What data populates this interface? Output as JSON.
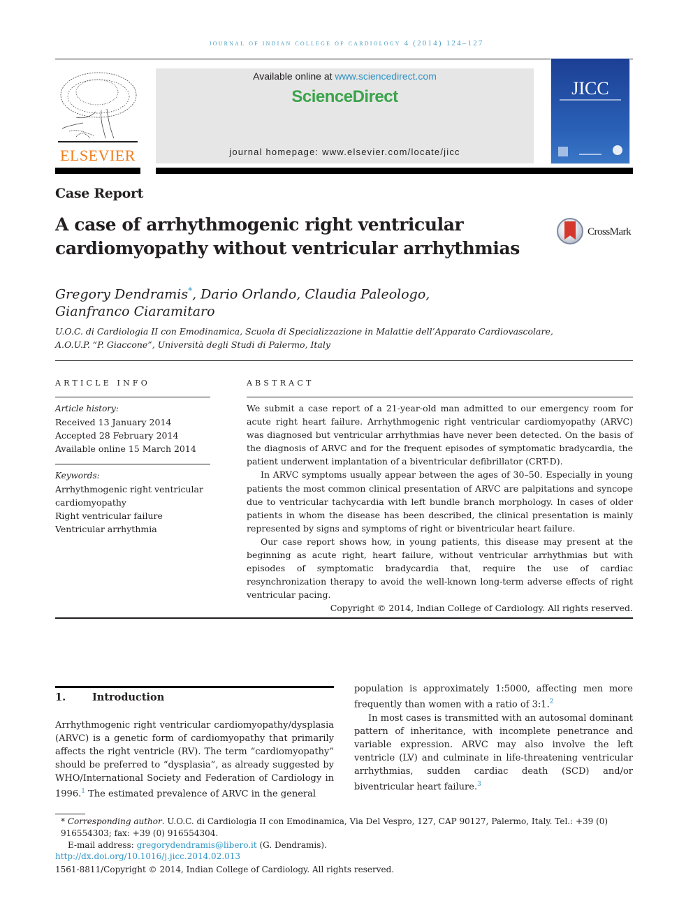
{
  "running_head": "Journal of Indian College of Cardiology 4 (2014) 124–127",
  "publisher": {
    "name": "ELSEVIER",
    "available_prefix": "Available online at ",
    "available_link": "www.sciencedirect.com",
    "platform": "ScienceDirect",
    "homepage": "journal homepage: www.elsevier.com/locate/jicc",
    "cover_title": "JICC"
  },
  "article": {
    "type": "Case Report",
    "title": "A case of arrhythmogenic right ventricular cardiomyopathy without ventricular arrhythmias",
    "crossmark_label": "CrossMark",
    "authors_line1_a": "Gregory Dendramis",
    "authors_mark": "*",
    "authors_line1_b": ", Dario Orlando, Claudia Paleologo,",
    "authors_line2": "Gianfranco Ciaramitaro",
    "affiliation_line1": "U.O.C. di Cardiologia II con Emodinamica, Scuola di Specializzazione in Malattie dell’Apparato Cardiovascolare,",
    "affiliation_line2": "A.O.U.P. “P. Giaccone”, Università degli Studi di Palermo, Italy"
  },
  "article_info": {
    "heading": "ARTICLE INFO",
    "history_label": "Article history:",
    "received": "Received 13 January 2014",
    "accepted": "Accepted 28 February 2014",
    "online": "Available online 15 March 2014",
    "keywords_label": "Keywords:",
    "keywords": [
      "Arrhythmogenic right ventricular cardiomyopathy",
      "Right ventricular failure",
      "Ventricular arrhythmia"
    ]
  },
  "abstract": {
    "heading": "ABSTRACT",
    "paragraphs": [
      "We submit a case report of a 21-year-old man admitted to our emergency room for acute right heart failure. Arrhythmogenic right ventricular cardiomyopathy (ARVC) was diagnosed but ventricular arrhythmias have never been detected. On the basis of the diagnosis of ARVC and for the frequent episodes of symptomatic bradycardia, the patient underwent implantation of a biventricular defibrillator (CRT-D).",
      "In ARVC symptoms usually appear between the ages of 30–50. Especially in young patients the most common clinical presentation of ARVC are palpitations and syncope due to ventricular tachycardia with left bundle branch morphology. In cases of older patients in whom the disease has been described, the clinical presentation is mainly represented by signs and symptoms of right or biventricular heart failure.",
      "Our case report shows how, in young patients, this disease may present at the beginning as acute right, heart failure, without ventricular arrhythmias but with episodes of symptomatic bradycardia that, require the use of cardiac resynchronization therapy to avoid the well-known long-term adverse effects of right ventricular pacing."
    ],
    "copyright": "Copyright © 2014, Indian College of Cardiology. All rights reserved."
  },
  "introduction": {
    "number": "1.",
    "heading": "Introduction",
    "p1_a": "Arrhythmogenic right ventricular cardiomyopathy/dysplasia (ARVC) is a genetic form of cardiomyopathy that primarily affects the right ventricle (RV). The term “cardiomyopathy” should be preferred to “dysplasia”, as already suggested by WHO/International Society and Federation of Cardiology in 1996.",
    "ref1": "1",
    "p1_b": " The estimated prevalence of ARVC in the general",
    "p1_c": "population is approximately 1:5000, affecting men more frequently than women with a ratio of 3:1.",
    "ref2": "2",
    "p2": "In most cases is transmitted with an autosomal dominant pattern of inheritance, with incomplete penetrance and variable expression. ARVC may also involve the left ventricle (LV) and culminate in life-threatening ventricular arrhythmias, sudden cardiac death (SCD) and/or biventricular heart failure.",
    "ref3": "3"
  },
  "footnotes": {
    "mark": "*",
    "corr_label": "Corresponding author",
    "corr_text": ". U.O.C. di Cardiologia II con Emodinamica, Via Del Vespro, 127, CAP 90127, Palermo, Italy. Tel.: +39 (0) 916554303; fax: +39 (0) 916554304.",
    "email_label": "E-mail address: ",
    "email": "gregorydendramis@libero.it",
    "email_suffix": " (G. Dendramis).",
    "doi": "http://dx.doi.org/10.1016/j.jicc.2014.02.013",
    "issn_copyright": "1561-8811/Copyright © 2014, Indian College of Cardiology. All rights reserved."
  }
}
